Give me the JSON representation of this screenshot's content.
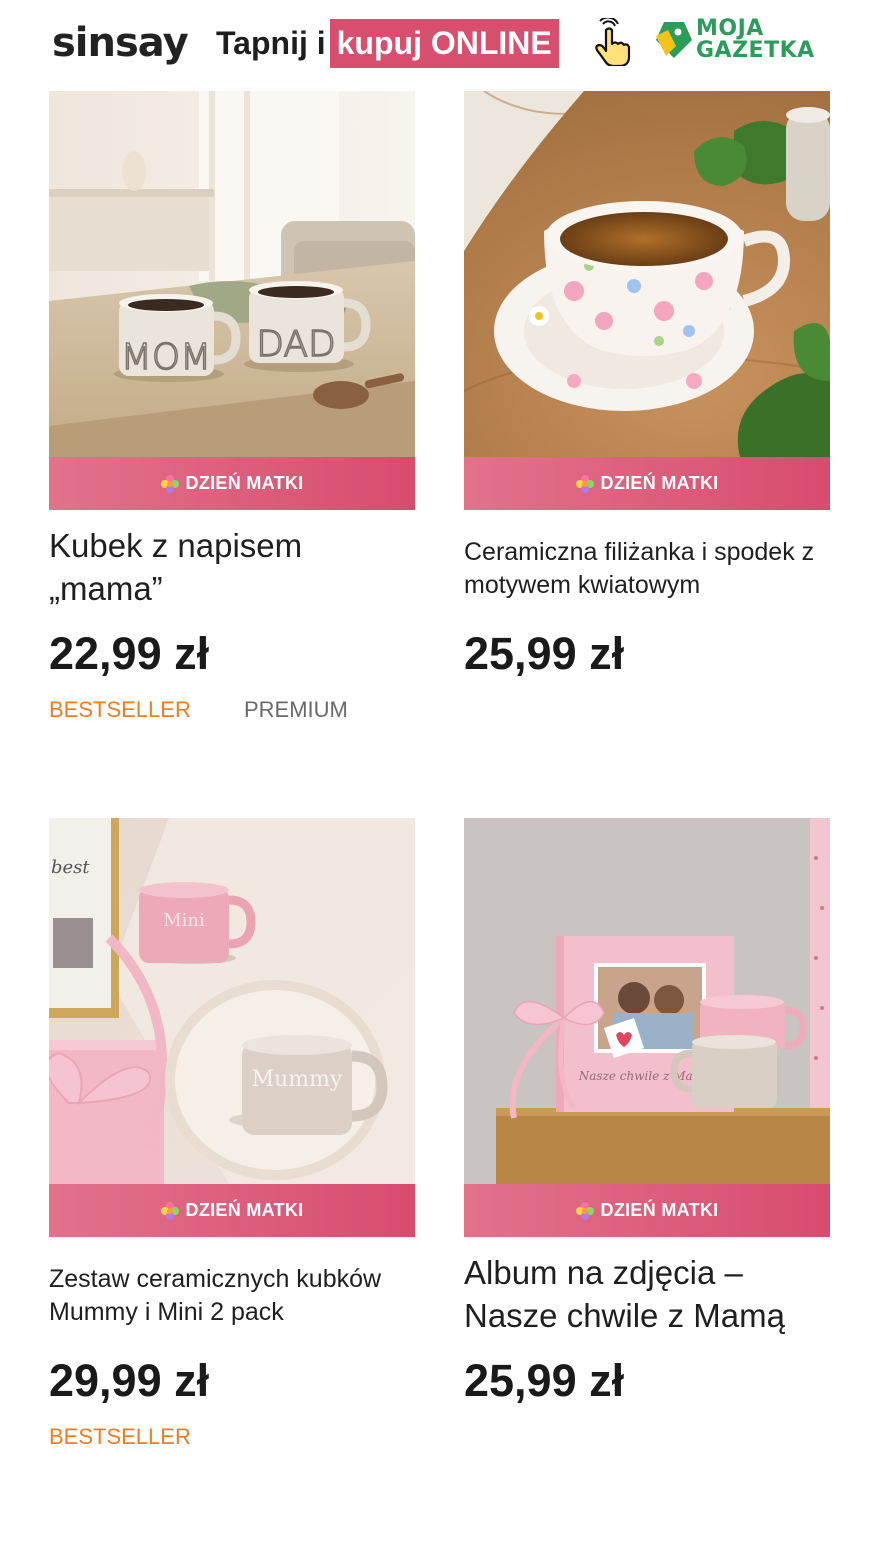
{
  "header": {
    "logo": "sinsay",
    "tagline_prefix": "Tapnij i",
    "tagline_highlight": "kupuj ONLINE",
    "tap_icon": "hand-pointer-icon",
    "moja_line1": "MOJA",
    "moja_line2": "GAZETKA",
    "brand_color": "#d84e6f",
    "moja_color": "#2c9c5a"
  },
  "products": [
    {
      "ribbon": "DZIEŃ MATKI",
      "title": "Kubek z napisem „mama”",
      "price": "22,99 zł",
      "tags": [
        "BESTSELLER",
        "PREMIUM"
      ]
    },
    {
      "ribbon": "DZIEŃ MATKI",
      "title": "Ceramiczna filiżanka i spodek z motywem kwiatowym",
      "price": "25,99 zł",
      "tags": []
    },
    {
      "ribbon": "DZIEŃ MATKI",
      "title": "Zestaw ceramicznych kubków Mummy i Mini 2 pack",
      "price": "29,99 zł",
      "tags": [
        "BESTSELLER"
      ]
    },
    {
      "ribbon": "DZIEŃ MATKI",
      "title": "Album na zdjęcia – Nasze chwile z Mamą",
      "price": "25,99 zł",
      "tags": []
    }
  ],
  "photo_text": {
    "mug_mom": "MOM",
    "mug_dad": "DAD",
    "mug_mini": "Mini",
    "mug_mummy": "Mummy",
    "frame_word": "best",
    "album_caption": "Nasze chwile z Mamą"
  },
  "colors": {
    "ribbon_start": "#e2728b",
    "ribbon_end": "#d84c6e",
    "tag_bestseller": "#ee7d22",
    "tag_premium": "#6a6a6a"
  }
}
